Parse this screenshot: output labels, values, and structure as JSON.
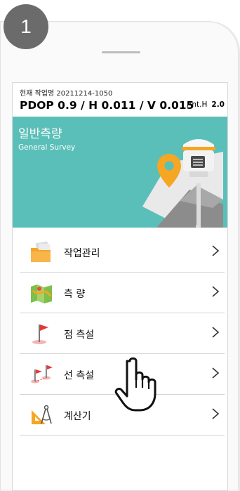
{
  "step": {
    "number": "1"
  },
  "header": {
    "job_label": "현재 작업명 20211214-1050",
    "status": "PDOP 0.9 / H 0.011 / V 0.015",
    "ant_label": "Ant.H",
    "ant_value": "2.0"
  },
  "banner": {
    "title": "일반측량",
    "subtitle": "General Survey",
    "color": "#5bbfb9"
  },
  "menu": {
    "items": [
      {
        "label": "작업관리",
        "icon": "folder-icon"
      },
      {
        "label": "측 량",
        "icon": "map-icon"
      },
      {
        "label": "점 측설",
        "icon": "point-flag-icon"
      },
      {
        "label": "선 측설",
        "icon": "line-flag-icon"
      },
      {
        "label": "계산기",
        "icon": "compass-ruler-icon"
      }
    ]
  }
}
